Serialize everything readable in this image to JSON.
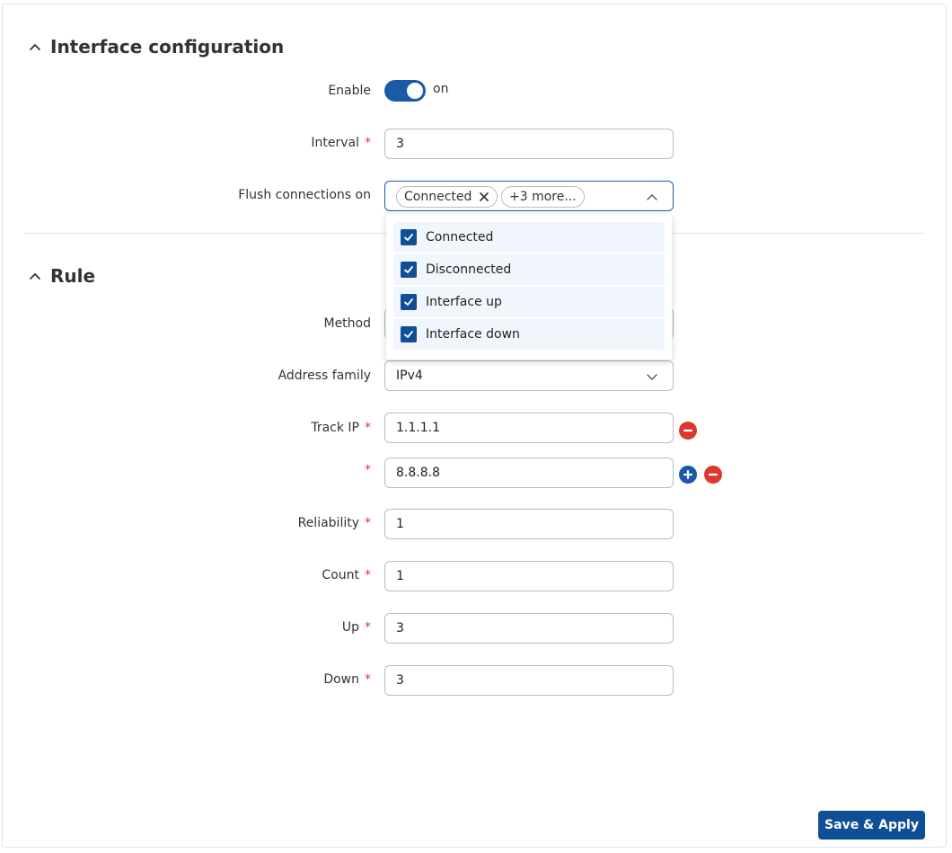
{
  "interface_section": {
    "title": "Interface configuration",
    "enable_label": "Enable",
    "enable_state": "on",
    "interval_label": "Interval",
    "interval_value": "3",
    "flush_label": "Flush connections on",
    "flush_chip": "Connected",
    "flush_more": "+3 more...",
    "flush_options": [
      "Connected",
      "Disconnected",
      "Interface up",
      "Interface down"
    ]
  },
  "rule_section": {
    "title": "Rule",
    "method_label": "Method",
    "address_family_label": "Address family",
    "address_family_value": "IPv4",
    "track_ip_label": "Track IP",
    "track_ip_values": [
      "1.1.1.1",
      "8.8.8.8"
    ],
    "reliability_label": "Reliability",
    "reliability_value": "1",
    "count_label": "Count",
    "count_value": "1",
    "up_label": "Up",
    "up_value": "3",
    "down_label": "Down",
    "down_value": "3"
  },
  "required_marker": "*",
  "actions": {
    "save_label": "Save & Apply"
  },
  "colors": {
    "accent": "#1a5aa6",
    "danger": "#d9392f",
    "option_bg": "#f0f6fc"
  }
}
